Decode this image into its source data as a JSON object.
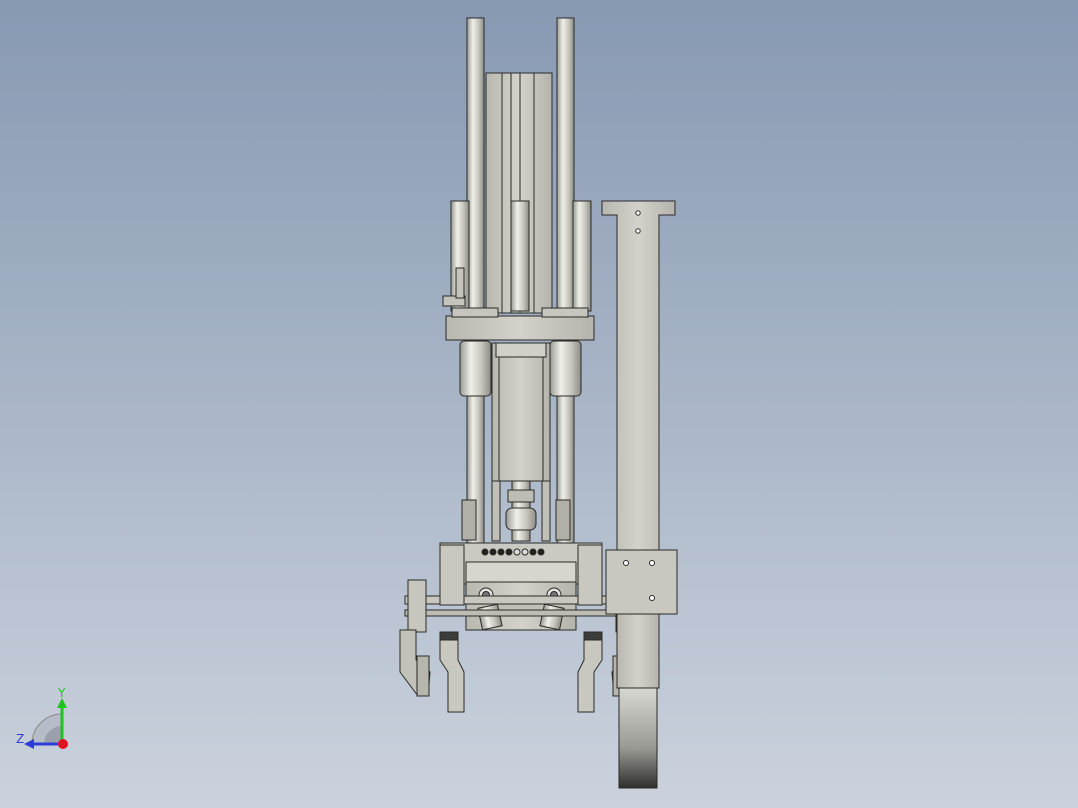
{
  "viewport": {
    "background_top": "#8a9cb4",
    "background_bottom": "#c9d0dc",
    "part_fill": "#c9c9c0",
    "part_dark": "#4a4a46",
    "rod_fill": "#d8d8d2"
  },
  "triad": {
    "y_label": "Y",
    "z_label": "Z",
    "y_color": "#1fc41f",
    "z_color": "#2c3ed6",
    "x_dot_color": "#e0141e"
  }
}
